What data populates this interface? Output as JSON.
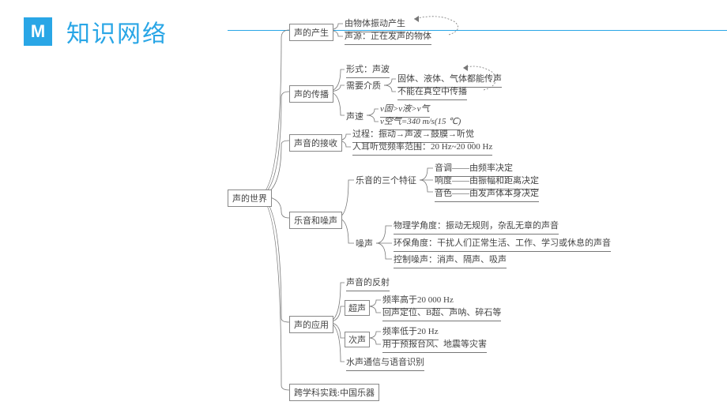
{
  "header": {
    "logo_text": "M",
    "title": "知识网络"
  },
  "root": "声的世界",
  "level1": {
    "n1": "声的产生",
    "n2": "声的传播",
    "n3": "声音的接收",
    "n4": "乐音和噪声",
    "n5": "声的应用",
    "n6": "跨学科实践:中国乐器"
  },
  "sound_gen": {
    "a": "由物体振动产生",
    "b": "声源：正在发声的物体"
  },
  "sound_prop": {
    "form": "形式：声波",
    "medium_label": "需要介质",
    "medium_a": "固体、液体、气体都能传声",
    "medium_b": "不能在真空中传播",
    "speed_label": "声速",
    "speed_a": "v固>v液>v气",
    "speed_b": "v空气=340 m/s(15 ℃)"
  },
  "sound_recv": {
    "a": "过程：振动→声波→鼓膜→听觉",
    "b": "人耳听觉频率范围：20 Hz~20 000 Hz"
  },
  "music_noise": {
    "m_label": "乐音的三个特征",
    "m_a": "音调——由频率决定",
    "m_b": "响度——由振幅和距离决定",
    "m_c": "音色——由发声体本身决定",
    "n_label": "噪声",
    "n_a": "物理学角度：振动无规则，杂乱无章的声音",
    "n_b": "环保角度：干扰人们正常生活、工作、学习或休息的声音",
    "n_c": "控制噪声：消声、隔声、吸声"
  },
  "sound_app": {
    "a": "声音的反射",
    "ultra_label": "超声",
    "ultra_a": "频率高于20 000 Hz",
    "ultra_b": "回声定位、B超、声呐、碎石等",
    "infra_label": "次声",
    "infra_a": "频率低于20 Hz",
    "infra_b": "用于预报台风、地震等灾害",
    "b": "水声通信与语音识别"
  }
}
